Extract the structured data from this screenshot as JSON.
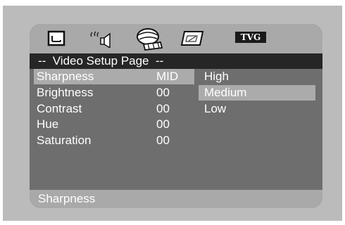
{
  "icon_bar": {
    "icons": [
      "general-setup-icon",
      "audio-setup-icon",
      "video-setup-icon",
      "preference-icon"
    ],
    "tvg_label": "TVG"
  },
  "title": "--  Video Setup Page  --",
  "menu": {
    "items": [
      {
        "label": "Sharpness",
        "value": "MID"
      },
      {
        "label": "Brightness",
        "value": "00"
      },
      {
        "label": "Contrast",
        "value": "00"
      },
      {
        "label": "Hue",
        "value": "00"
      },
      {
        "label": "Saturation",
        "value": "00"
      }
    ]
  },
  "options": {
    "items": [
      "High",
      "Medium",
      "Low"
    ]
  },
  "status": "Sharpness"
}
